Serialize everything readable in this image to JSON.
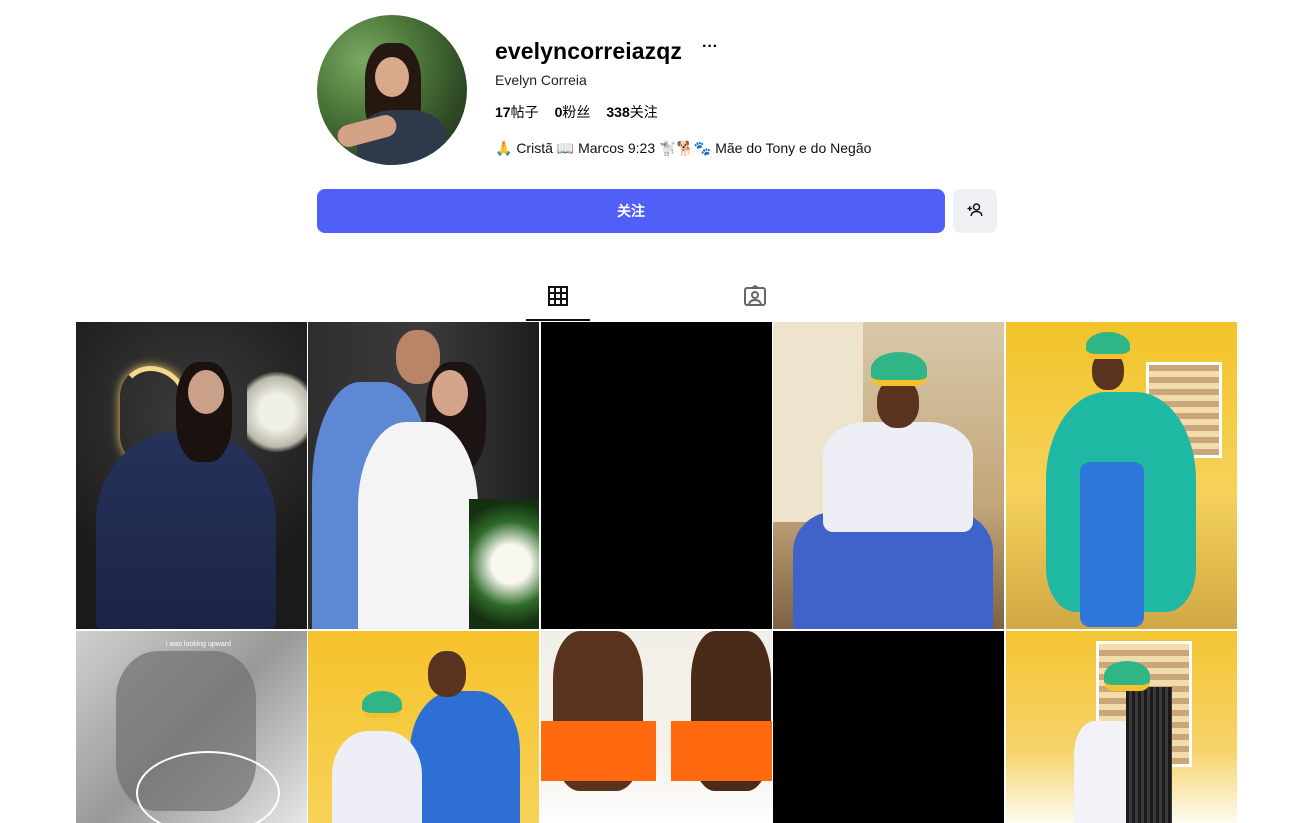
{
  "profile": {
    "username": "evelyncorreiazqz",
    "more_label": "···",
    "display_name": "Evelyn Correia",
    "stats": {
      "posts_value": "17",
      "posts_label": "帖子",
      "followers_value": "0",
      "followers_label": "粉丝",
      "following_value": "338",
      "following_label": "关注"
    },
    "bio": "🙏 Cristã 📖 Marcos 9:23 🐩🐕🐾 Mãe do Tony e do Negão"
  },
  "actions": {
    "follow_label": "关注",
    "add_user_icon": "add-user-icon"
  },
  "tabs": [
    {
      "icon": "grid-icon",
      "active": true
    },
    {
      "icon": "tagged-icon",
      "active": false
    }
  ],
  "posts": [
    {
      "kind": "photo"
    },
    {
      "kind": "photo"
    },
    {
      "kind": "black"
    },
    {
      "kind": "photo"
    },
    {
      "kind": "photo"
    },
    {
      "kind": "photo",
      "overlay_text": "i was looking upward"
    },
    {
      "kind": "photo"
    },
    {
      "kind": "photo"
    },
    {
      "kind": "black"
    },
    {
      "kind": "photo"
    }
  ]
}
